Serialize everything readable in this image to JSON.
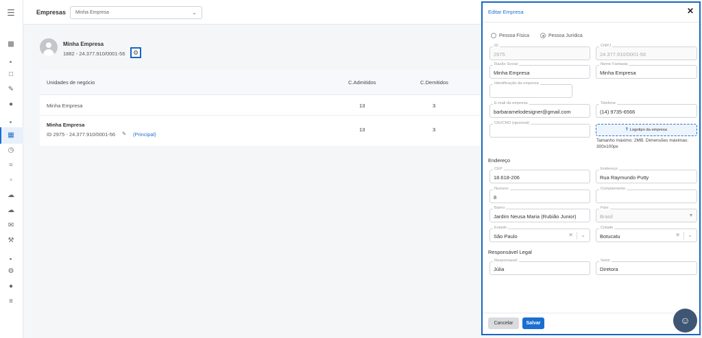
{
  "topbar": {
    "title": "Empresas",
    "company_select": "Minha Empresa"
  },
  "sidebar": {
    "icons": [
      "menu-icon",
      "chart-icon",
      "document-icon",
      "pen-icon",
      "user-icon",
      "building-icon",
      "clock-icon",
      "trend-icon",
      "chat-icon",
      "cloud-icon",
      "cloud-icon",
      "mail-icon",
      "wrench-icon",
      "gear-icon",
      "user-icon",
      "list-icon"
    ]
  },
  "company": {
    "name": "Minha Empresa",
    "subtitle": "1882 - 24.377.910/0001-56"
  },
  "table": {
    "headers": [
      "Unidades de negócio",
      "C.Admitidos",
      "C.Demitidos"
    ],
    "rows": [
      {
        "name": "Minha Empresa",
        "admitidos": "13",
        "demitidos": "3"
      },
      {
        "name": "Minha Empresa",
        "id_line": "ID 2975 - 24.377.910/0001-56",
        "tag": "(Principal)",
        "admitidos": "13",
        "demitidos": "3"
      }
    ]
  },
  "panel": {
    "title": "Editar Empresa",
    "person_fisica": "Pessoa Física",
    "person_juridica": "Pessoa Jurídica",
    "fields": {
      "id": {
        "label": "ID",
        "value": "2975"
      },
      "cnpj": {
        "label": "CNPJ",
        "value": "24.377.910/0001-56"
      },
      "razao": {
        "label": "Razão Social",
        "value": "Minha Empresa"
      },
      "fantasia": {
        "label": "Nome Fantasia",
        "value": "Minha Empresa"
      },
      "ident": {
        "label": "Identificação da empresa",
        "value": ""
      },
      "email": {
        "label": "E-mail da empresa",
        "value": "barbaramelodesigner@gmail.com"
      },
      "telefone": {
        "label": "Telefone",
        "value": "(14) 9735-6566"
      },
      "cei": {
        "label": "CEI/CNO (opcional)",
        "value": ""
      },
      "cep": {
        "label": "CEP",
        "value": "18.618-206"
      },
      "endereco": {
        "label": "Endereço",
        "value": "Rua Raymundo Putty"
      },
      "numero": {
        "label": "Numero",
        "value": "8"
      },
      "complemento": {
        "label": "Complemento",
        "value": ""
      },
      "bairro": {
        "label": "Bairro",
        "value": "Jardim Neusa Maria (Rubião Junior)"
      },
      "pais": {
        "label": "País",
        "value": "Brasil"
      },
      "estado": {
        "label": "Estado",
        "value": "São Paulo"
      },
      "cidade": {
        "label": "Cidade",
        "value": "Botucatu"
      },
      "responsavel": {
        "label": "Responsavel",
        "value": "Júlia"
      },
      "setor": {
        "label": "Setor",
        "value": "Diretora"
      }
    },
    "logo_button": "Logotipo da empresa",
    "logo_note": "Tamanho máximo: 2MB. Dimensões máximas: 300x100px",
    "section_endereco": "Endereço",
    "section_responsavel": "Responsável Legal",
    "cancel": "Cancelar",
    "save": "Salvar"
  },
  "colors": {
    "accent": "#1a6fd1",
    "highlight_border": "#1565c0",
    "help_fab": "#3f5574"
  }
}
